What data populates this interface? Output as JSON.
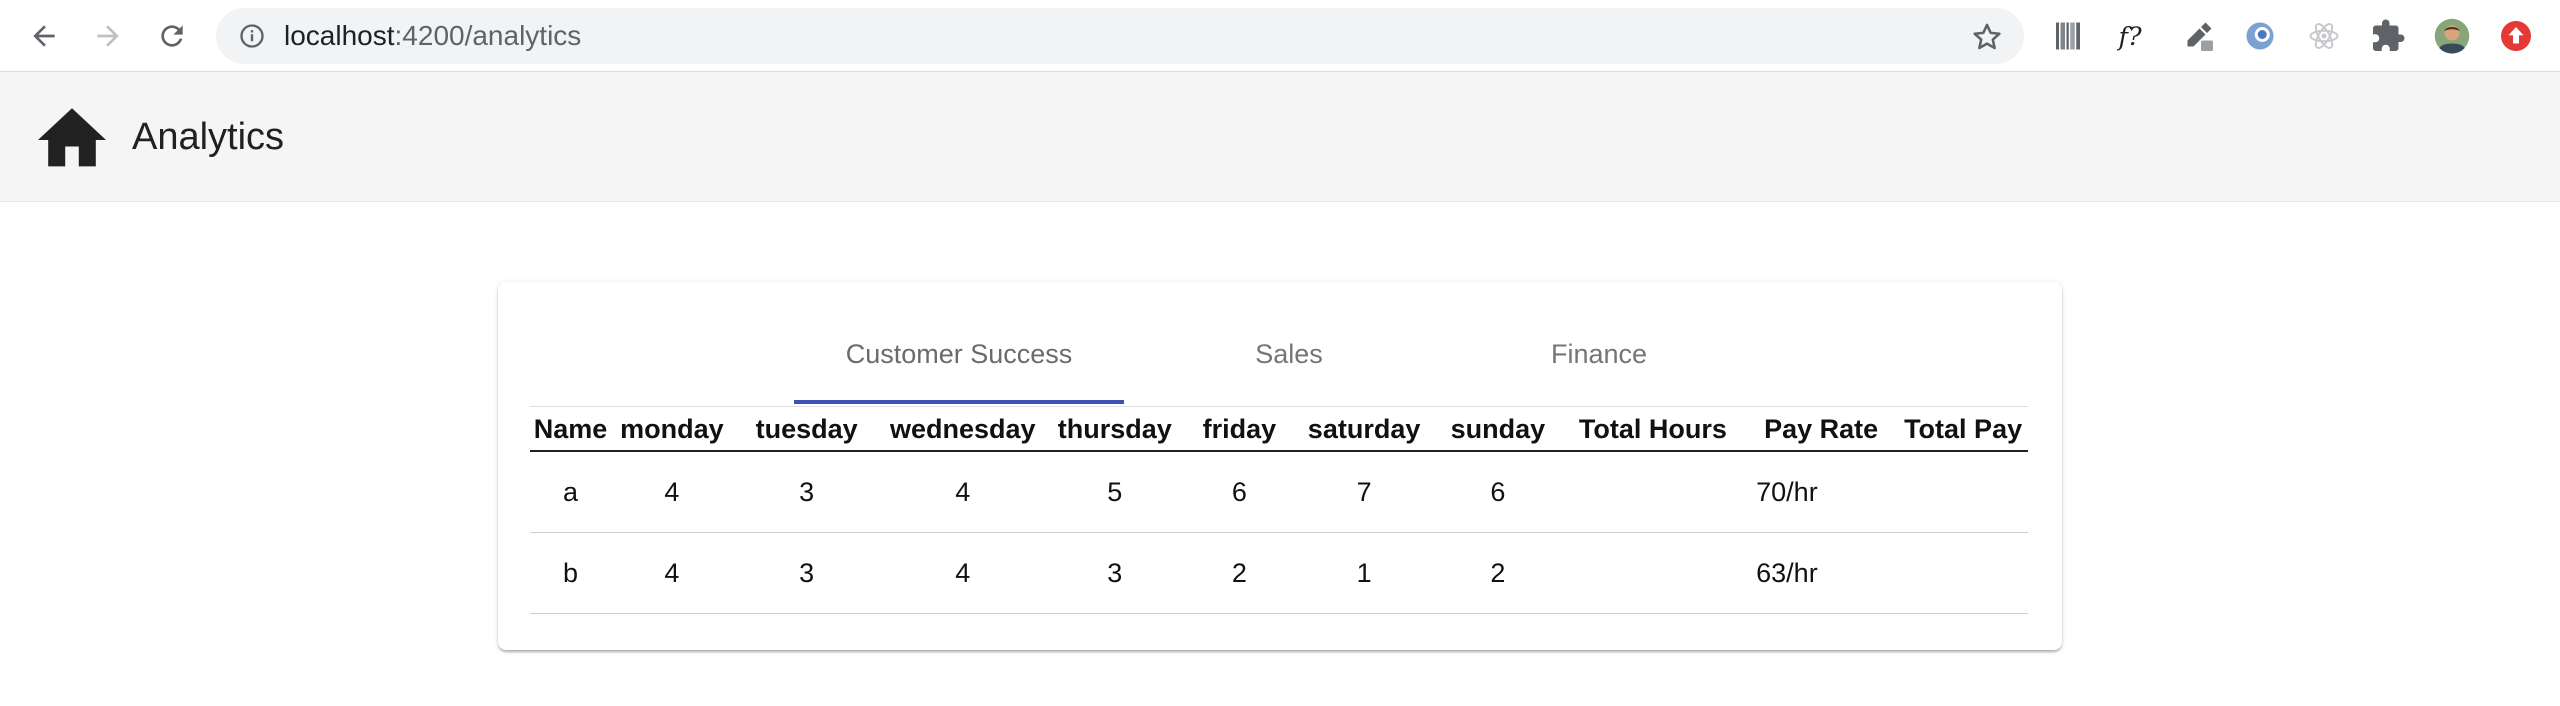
{
  "browser": {
    "url_host": "localhost",
    "url_path": ":4200/analytics",
    "extensions": [
      "barcode-icon",
      "fx-icon",
      "eyedropper-icon",
      "ring-extension-icon",
      "react-icon",
      "puzzle-icon",
      "profile-avatar",
      "update-icon"
    ]
  },
  "app": {
    "title": "Analytics"
  },
  "tabs": [
    {
      "label": "Customer Success",
      "active": true
    },
    {
      "label": "Sales",
      "active": false
    },
    {
      "label": "Finance",
      "active": false
    }
  ],
  "table": {
    "headers": [
      "Name",
      "monday",
      "tuesday",
      "wednesday",
      "thursday",
      "friday",
      "saturday",
      "sunday",
      "Total Hours",
      "Pay Rate",
      "Total Pay"
    ],
    "rows": [
      [
        "a",
        "4",
        "3",
        "4",
        "5",
        "6",
        "7",
        "6",
        "",
        "70/hr",
        ""
      ],
      [
        "b",
        "4",
        "3",
        "4",
        "3",
        "2",
        "1",
        "2",
        "",
        "63/hr",
        ""
      ]
    ]
  },
  "colors": {
    "tab_ink": "#3f51b5",
    "app_bar": "#f5f5f5",
    "update_badge": "#e53935"
  }
}
